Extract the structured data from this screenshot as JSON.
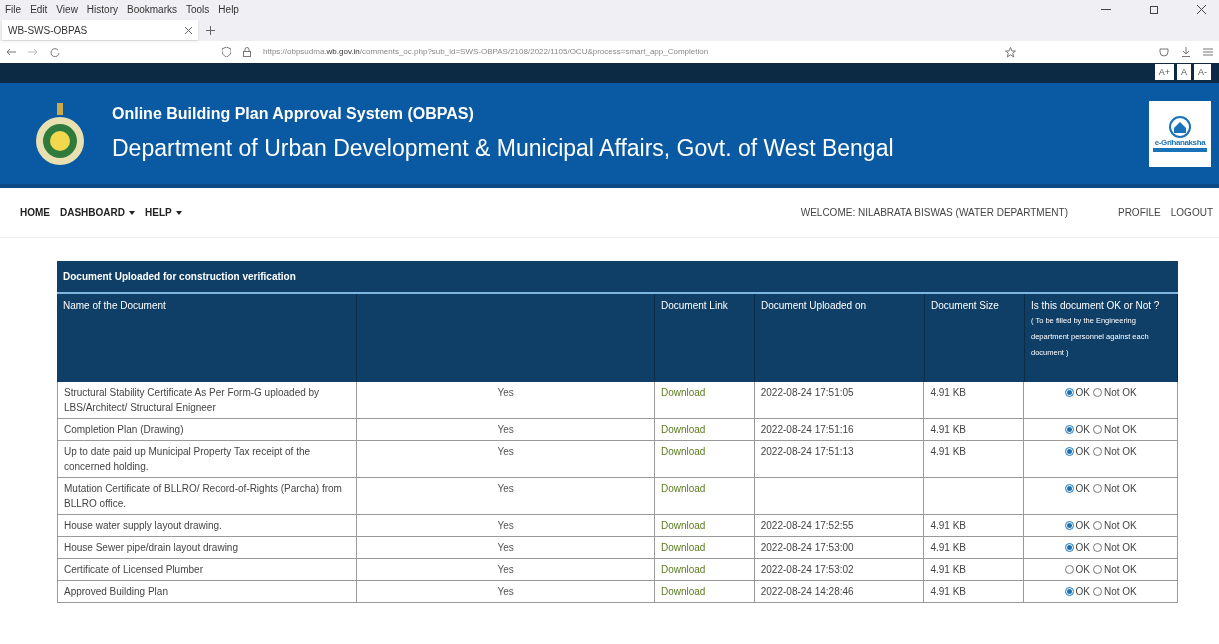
{
  "browser": {
    "menu": [
      "File",
      "Edit",
      "View",
      "History",
      "Bookmarks",
      "Tools",
      "Help"
    ],
    "tabs": [
      {
        "label": "WB-SWS-OBPAS",
        "selected": true
      }
    ],
    "url": "https://obpsudma.**wb.gov.in**/comments_oc.php?sub_id=SWS-OBPAS/2108/2022/1105/OCU&process=smart_app_Completion"
  },
  "font_sizes": [
    "A+",
    "A",
    "A-"
  ],
  "header": {
    "title": "Online Building Plan Approval System (OBPAS)",
    "subtitle": "Department of Urban Development & Municipal Affairs, Govt. of West Bengal",
    "logo_text": "e-Grihanaksha"
  },
  "nav": {
    "left": [
      {
        "label": "HOME",
        "dropdown": false
      },
      {
        "label": "DASHBOARD",
        "dropdown": true
      },
      {
        "label": "HELP",
        "dropdown": true
      }
    ],
    "welcome": "WELCOME: NILABRATA BISWAS (WATER DEPARTMENT)",
    "right": [
      "PROFILE",
      "LOGOUT"
    ]
  },
  "table": {
    "title": "Document Uploaded for construction verification",
    "columns": [
      "Name of the Document",
      "",
      "Document Link",
      "Document Uploaded on",
      "Document Size",
      "Is this document OK or Not ?"
    ],
    "ok_note": "( To be filled by the Engineering department personnel against each document )",
    "rows": [
      {
        "name": "Structural Stability Certificate As Per Form-G uploaded by LBS/Architect/ Structural Enigneer",
        "uploaded": "Yes",
        "link": "Download",
        "date": "2022-08-24 17:51:05",
        "size": "4.91 KB",
        "options": [
          {
            "label": "OK",
            "selected": true
          },
          {
            "label": "Not OK",
            "selected": false
          }
        ]
      },
      {
        "name": "Completion Plan (Drawing)",
        "uploaded": "Yes",
        "link": "Download",
        "date": "2022-08-24 17:51:16",
        "size": "4.91 KB",
        "options": [
          {
            "label": "OK",
            "selected": true
          },
          {
            "label": "Not OK",
            "selected": false
          }
        ]
      },
      {
        "name": "Up to date paid up Municipal Property Tax receipt of the concerned holding.",
        "uploaded": "Yes",
        "link": "Download",
        "date": "2022-08-24 17:51:13",
        "size": "4.91 KB",
        "options": [
          {
            "label": "OK",
            "selected": true
          },
          {
            "label": "Not OK",
            "selected": false
          }
        ]
      },
      {
        "name": "Mutation Certificate of BLLRO/ Record-of-Rights (Parcha) from BLLRO office.",
        "uploaded": "Yes",
        "link": "Download",
        "options": [
          {
            "label": "OK",
            "selected": true
          },
          {
            "label": "Not OK",
            "selected": false
          }
        ]
      },
      {
        "name": "House water supply layout drawing.",
        "uploaded": "Yes",
        "link": "Download",
        "date": "2022-08-24 17:52:55",
        "size": "4.91 KB",
        "options": [
          {
            "label": "OK",
            "selected": true
          },
          {
            "label": "Not OK",
            "selected": false
          }
        ]
      },
      {
        "name": "House Sewer pipe/drain layout drawing",
        "uploaded": "Yes",
        "link": "Download",
        "date": "2022-08-24 17:53:00",
        "size": "4.91 KB",
        "options": [
          {
            "label": "OK",
            "selected": true
          },
          {
            "label": "Not OK",
            "selected": false
          }
        ]
      },
      {
        "name": "Certificate of Licensed Plumber",
        "uploaded": "Yes",
        "link": "Download",
        "date": "2022-08-24 17:53:02",
        "size": "4.91 KB",
        "options": [
          {
            "label": "OK",
            "selected": false
          },
          {
            "label": "Not OK",
            "selected": false
          }
        ]
      },
      {
        "name": "Approved Building Plan",
        "uploaded": "Yes",
        "link": "Download",
        "date": "2022-08-24 14:28:46",
        "size": "4.91 KB",
        "options": [
          {
            "label": "OK",
            "selected": true
          },
          {
            "label": "Not OK",
            "selected": false
          }
        ]
      }
    ]
  }
}
